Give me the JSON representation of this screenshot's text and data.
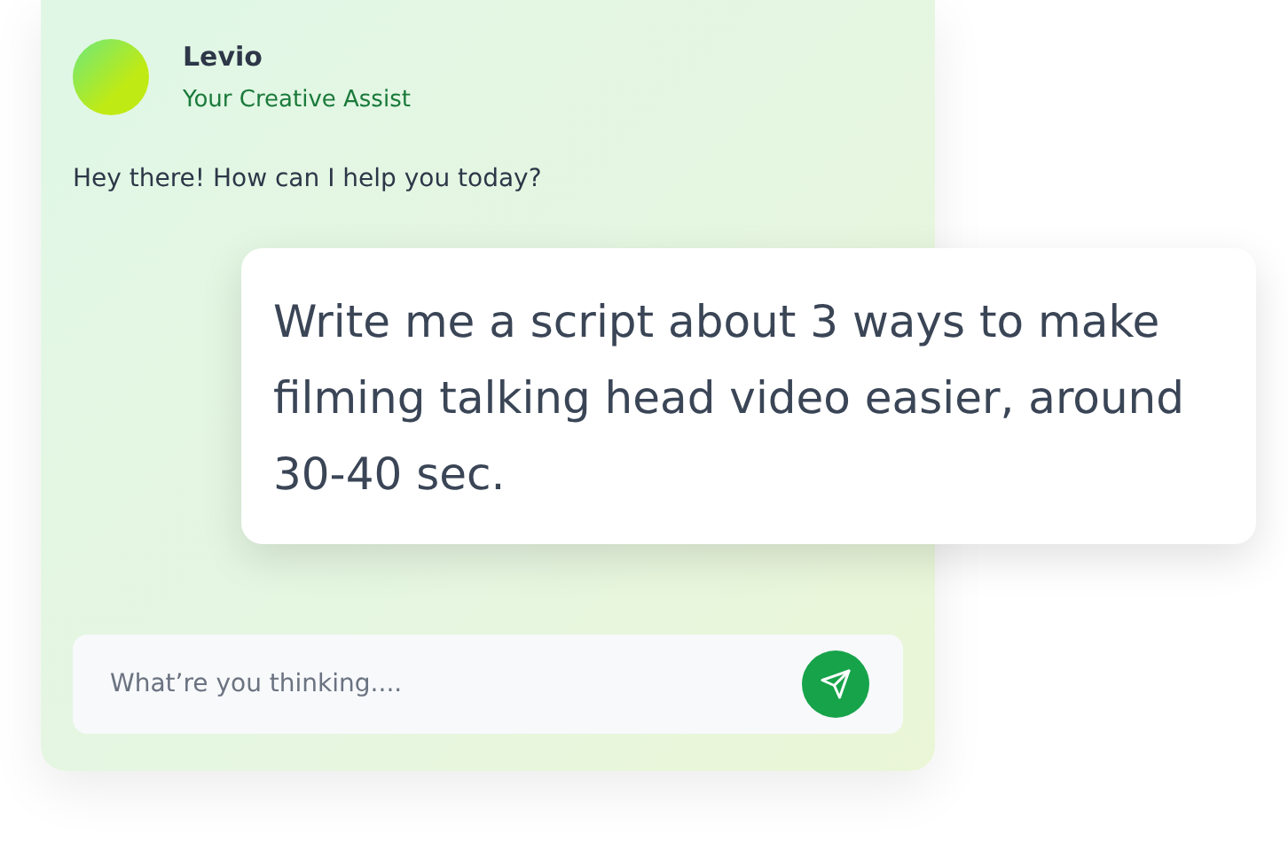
{
  "assistant": {
    "name": "Levio",
    "subtitle": "Your Creative Assist"
  },
  "greeting": "Hey there! How can I help you today?",
  "prompt": "Write me a script about 3 ways to make filming talking head video easier, around 30-40 sec.",
  "composer": {
    "placeholder": "What’re you thinking...."
  }
}
